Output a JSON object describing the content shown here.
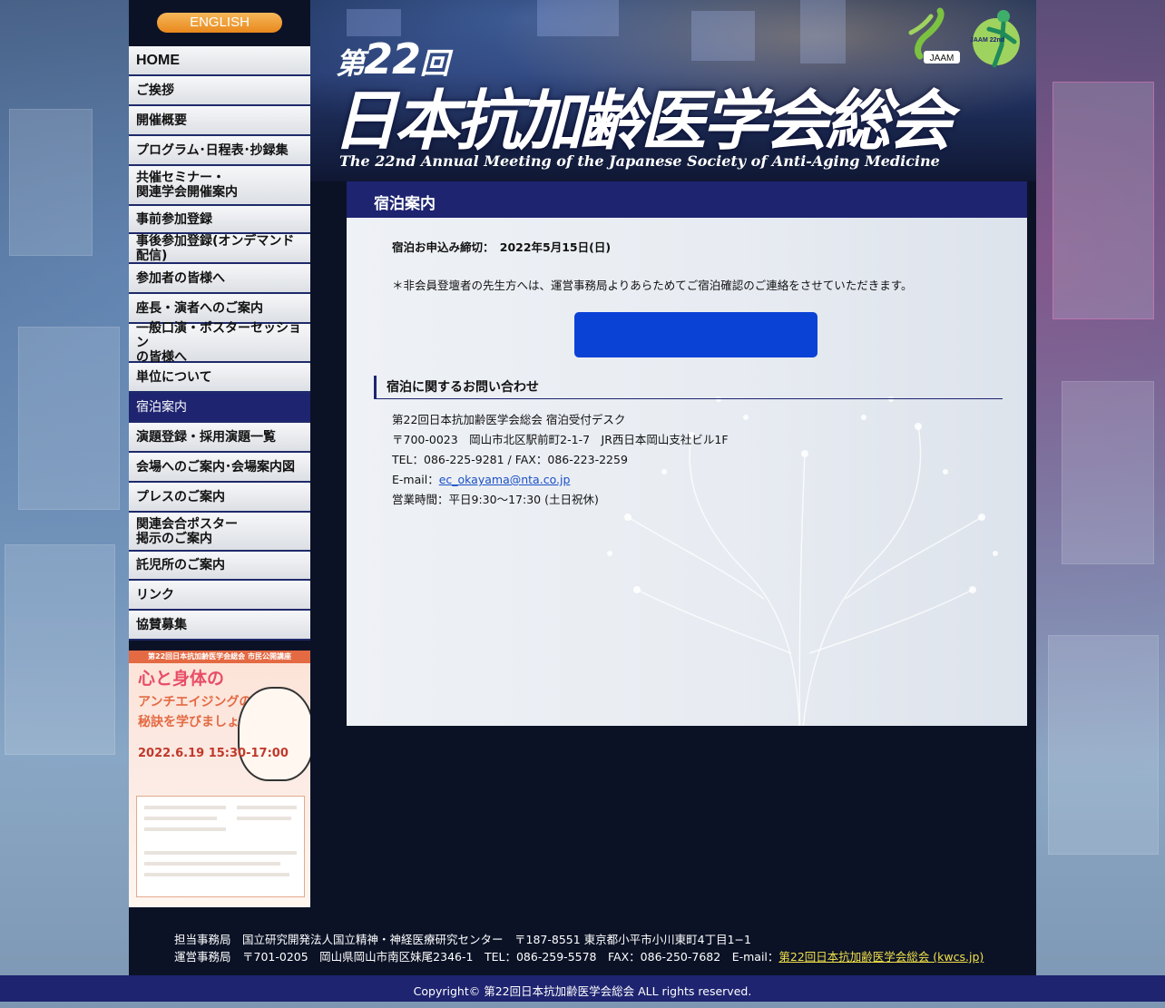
{
  "sidebar": {
    "english_label": "ENGLISH",
    "items": [
      {
        "label": "HOME"
      },
      {
        "label": "ご挨拶"
      },
      {
        "label": "開催概要"
      },
      {
        "label": "プログラム･日程表･抄録集"
      },
      {
        "label": "共催セミナー・\n関連学会開催案内"
      },
      {
        "label": "事前参加登録"
      },
      {
        "label": "事後参加登録(オンデマンド配信)"
      },
      {
        "label": "参加者の皆様へ"
      },
      {
        "label": "座長・演者へのご案内"
      },
      {
        "label": "一般口演・ポスターセッション\nの皆様へ"
      },
      {
        "label": "単位について"
      },
      {
        "label": "宿泊案内"
      },
      {
        "label": "演題登録・採用演題一覧"
      },
      {
        "label": "会場へのご案内･会場案内図"
      },
      {
        "label": "プレスのご案内"
      },
      {
        "label": "関連会合ポスター\n掲示のご案内"
      },
      {
        "label": "託児所のご案内"
      },
      {
        "label": "リンク"
      },
      {
        "label": "協賛募集"
      }
    ],
    "active_index": 11,
    "banner": {
      "header": "第22回日本抗加齢医学会総会 市民公開講座",
      "title_line1": "心と身体の",
      "title_line2": "アンチエイジングの\n秘訣を学びましょ",
      "date": "2022.6.19 15:30-17:00"
    }
  },
  "header": {
    "dai": "第",
    "number": "22",
    "kai": "回",
    "title": "日本抗加齢医学会総会",
    "subtitle": "The 22nd Annual Meeting of the Japanese Society of Anti-Aging Medicine",
    "logo1_text": "JAAM",
    "logo2_text": "JAAM 22nd"
  },
  "main": {
    "page_title": "宿泊案内",
    "deadline": "宿泊お申込み締切：　2022年5月15日(日)",
    "note": "＊非会員登壇者の先生方へは、運営事務局よりあらためてご宿泊確認のご連絡をさせていただきます。",
    "section_title": "宿泊に関するお問い合わせ",
    "contact": {
      "name": "第22回日本抗加齢医学会総会 宿泊受付デスク",
      "address": "〒700-0023　岡山市北区駅前町2-1-7　JR西日本岡山支社ビル1F",
      "tel_fax": "TEL：086-225-9281 / FAX：086-223-2259",
      "email_label": "E-mail：",
      "email": "ec_okayama@nta.co.jp",
      "hours": "営業時間：平日9:30〜17:30 (土日祝休)"
    }
  },
  "footer": {
    "line1": "担当事務局　国立研究開発法人国立精神・神経医療研究センター　〒187-8551 東京都小平市小川東町4丁目1−1",
    "line2_prefix": "運営事務局　〒701-0205　岡山県岡山市南区妹尾2346-1　TEL：086-259-5578　FAX：086-250-7682　E-mail：",
    "line2_link": "第22回日本抗加齢医学会総会 (kwcs.jp)",
    "copyright": "Copyright© 第22回日本抗加齢医学会総会 ALL rights reserved."
  },
  "colors": {
    "navy": "#1e2470",
    "button_blue": "#0a42d6",
    "english_orange": "#e8891c",
    "footer_link": "#f2e14a"
  }
}
